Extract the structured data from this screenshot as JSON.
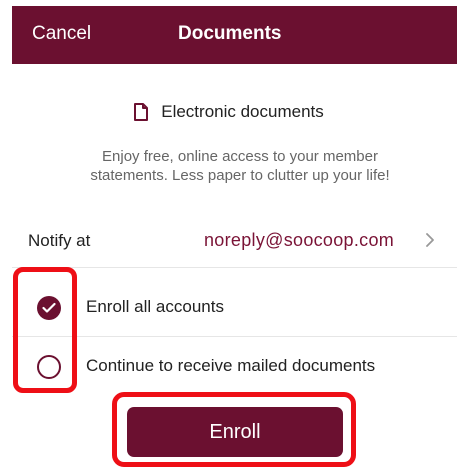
{
  "header": {
    "cancel_label": "Cancel",
    "title": "Documents"
  },
  "section": {
    "icon": "document-icon",
    "title": "Electronic documents",
    "description_line1": "Enjoy free, online access to your member",
    "description_line2": "statements. Less paper to clutter up your life!"
  },
  "notify": {
    "label": "Notify at",
    "email": "noreply@soocoop.com",
    "icon": "chevron-right-icon"
  },
  "options": [
    {
      "label": "Enroll all accounts",
      "selected": true
    },
    {
      "label": "Continue to receive mailed documents",
      "selected": false
    }
  ],
  "enroll_button": {
    "label": "Enroll"
  },
  "colors": {
    "brand": "#6b1030",
    "highlight": "#ee0f16",
    "muted_text": "#666666"
  }
}
